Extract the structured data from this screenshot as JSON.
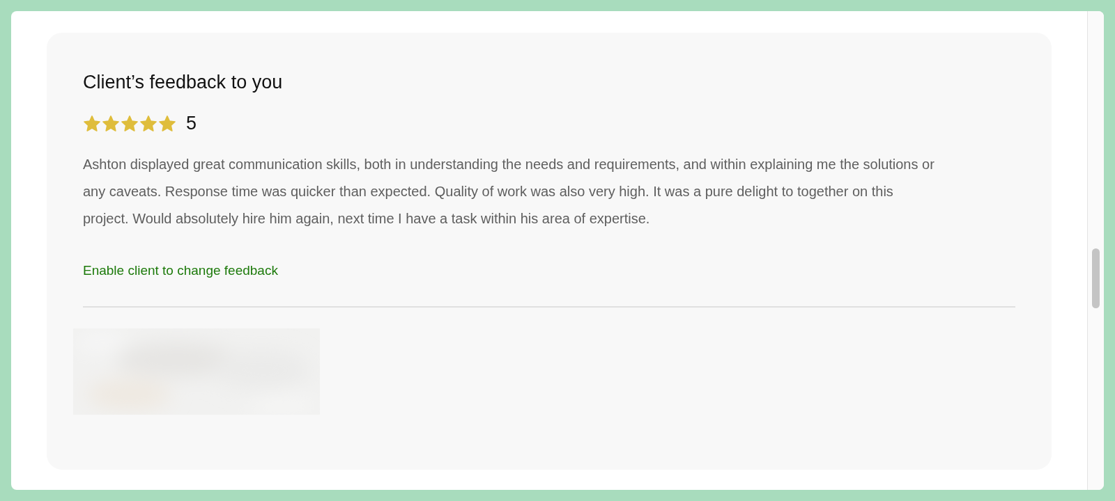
{
  "feedback": {
    "title": "Client’s feedback to you",
    "stars": 5,
    "rating": "5",
    "comment": "Ashton displayed great communication skills, both in understanding the needs and requirements, and within explaining me the solutions or any caveats. Response time was quicker than expected. Quality of work was also very high. It was a pure delight to together on this project. Would absolutely hire him again, next time I have a task within his area of expertise.",
    "link": "Enable client to change feedback"
  }
}
